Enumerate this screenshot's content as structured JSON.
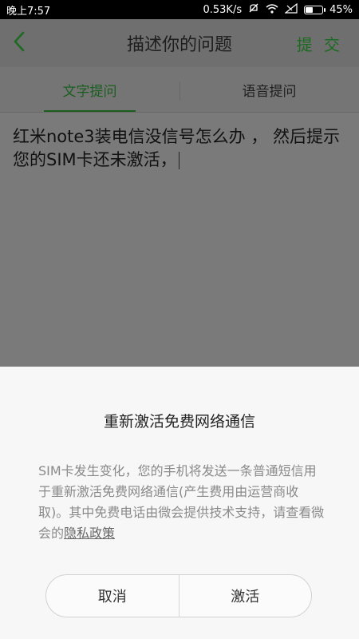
{
  "status_bar": {
    "time": "晚上7:57",
    "speed": "0.53K/s",
    "battery_level": "45%",
    "battery_fraction": 0.45
  },
  "header": {
    "title": "描述你的问题",
    "submit_label": "提 交",
    "back_icon": "chevron-left-icon"
  },
  "tabs": [
    {
      "label": "文字提问",
      "active": true
    },
    {
      "label": "语音提问",
      "active": false
    }
  ],
  "question": {
    "text": "红米note3装电信没信号怎么办 ， 然后提示您的SIM卡还未激活，"
  },
  "dialog": {
    "title": "重新激活免费网络通信",
    "body": "SIM卡发生变化，您的手机将发送一条普通短信用于重新激活免费网络通信(产生费用由运营商收取)。其中免费电话由微会提供技术支持，请查看微会的",
    "link": "隐私政策",
    "cancel_label": "取消",
    "activate_label": "激活"
  },
  "colors": {
    "accent": "#1d6a22",
    "overlay": "#7a7a7a",
    "dialog_bg": "#f7f7f7"
  }
}
